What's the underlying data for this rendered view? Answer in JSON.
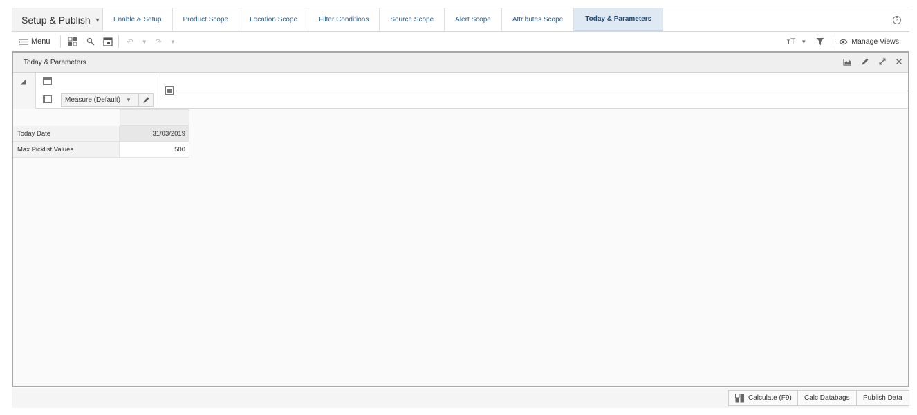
{
  "tabs": {
    "main": {
      "label": "Setup & Publish"
    },
    "items": [
      {
        "label": "Enable & Setup"
      },
      {
        "label": "Product Scope"
      },
      {
        "label": "Location Scope"
      },
      {
        "label": "Filter Conditions"
      },
      {
        "label": "Source Scope"
      },
      {
        "label": "Alert Scope"
      },
      {
        "label": "Attributes Scope"
      },
      {
        "label": "Today & Parameters",
        "active": true
      }
    ],
    "help_glyph": "?"
  },
  "toolbar": {
    "menu_label": "Menu",
    "manage_views_label": "Manage Views"
  },
  "panel": {
    "title": "Today & Parameters",
    "measure_dropdown": {
      "selected": "Measure (Default)"
    }
  },
  "grid": {
    "rows": [
      {
        "label": "Today Date",
        "value": "31/03/2019",
        "editable": false
      },
      {
        "label": "Max Picklist Values",
        "value": "500",
        "editable": true
      }
    ]
  },
  "footer": {
    "calculate_label": "Calculate (F9)",
    "calc_databags_label": "Calc Databags",
    "publish_data_label": "Publish Data"
  },
  "colors": {
    "active_tab_bg": "#dfe9f3",
    "tab_link": "#2f5f8f",
    "panel_border": "#a8a8a8"
  }
}
